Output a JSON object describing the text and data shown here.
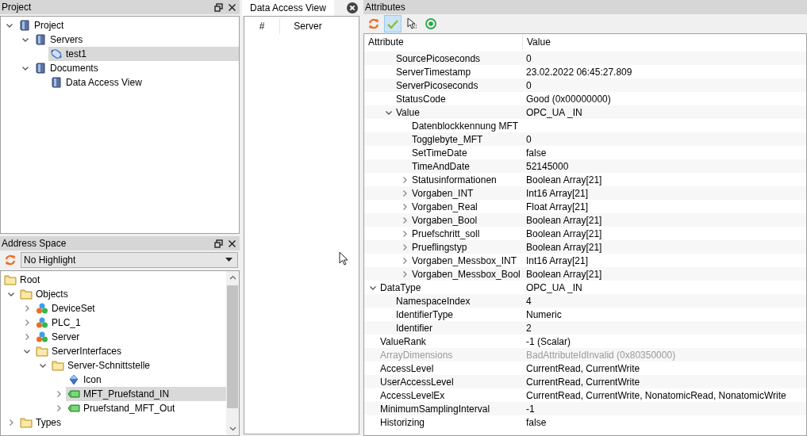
{
  "project_panel": {
    "title": "Project",
    "tree": [
      {
        "label": "Project",
        "kind": "book",
        "expanded": true,
        "selected": false,
        "children": [
          {
            "label": "Servers",
            "kind": "book",
            "expanded": true,
            "selected": false,
            "children": [
              {
                "label": "test1",
                "kind": "connection",
                "selected": true
              }
            ]
          },
          {
            "label": "Documents",
            "kind": "book",
            "expanded": true,
            "selected": false,
            "children": [
              {
                "label": "Data Access View",
                "kind": "book",
                "selected": false
              }
            ]
          }
        ]
      }
    ]
  },
  "address_space": {
    "title": "Address Space",
    "highlight": "No Highlight",
    "tree": [
      {
        "label": "Root",
        "kind": "folder",
        "selected": false,
        "children": [
          {
            "label": "Objects",
            "kind": "folder",
            "expanded": true,
            "selected": false,
            "children": [
              {
                "label": "DeviceSet",
                "kind": "object",
                "expanded": false,
                "selected": false
              },
              {
                "label": "PLC_1",
                "kind": "object",
                "expanded": false,
                "selected": false
              },
              {
                "label": "Server",
                "kind": "object",
                "expanded": false,
                "selected": false
              },
              {
                "label": "ServerInterfaces",
                "kind": "folder",
                "expanded": true,
                "selected": false,
                "children": [
                  {
                    "label": "Server-Schnittstelle",
                    "kind": "folder",
                    "expanded": true,
                    "selected": false,
                    "children": [
                      {
                        "label": "Icon",
                        "kind": "property",
                        "selected": false
                      },
                      {
                        "label": "MFT_Pruefstand_IN",
                        "kind": "variable",
                        "expanded": false,
                        "selected": true
                      },
                      {
                        "label": "Pruefstand_MFT_Out",
                        "kind": "variable",
                        "expanded": false,
                        "selected": false
                      }
                    ]
                  }
                ]
              }
            ]
          },
          {
            "label": "Types",
            "kind": "folder",
            "expanded": false,
            "selected": false
          }
        ]
      }
    ]
  },
  "data_access_view": {
    "tab": "Data Access View",
    "columns": [
      "#",
      "Server"
    ]
  },
  "attributes": {
    "title": "Attributes",
    "toolbar": [
      {
        "kind": "refresh",
        "on": false
      },
      {
        "kind": "check",
        "on": true
      },
      {
        "kind": "pointer",
        "on": false
      },
      {
        "kind": "target",
        "on": false
      }
    ],
    "columns": [
      "Attribute",
      "Value"
    ],
    "rows": [
      {
        "children": [
          {
            "name": "SourcePicoseconds",
            "value": "0",
            "disabled": false
          },
          {
            "name": "ServerTimestamp",
            "value": "23.02.2022 06:45:27.809",
            "disabled": false
          },
          {
            "name": "ServerPicoseconds",
            "value": "0",
            "disabled": false
          },
          {
            "name": "StatusCode",
            "value": "Good (0x00000000)",
            "disabled": false
          },
          {
            "name": "Value",
            "value": "OPC_UA _IN",
            "disabled": false,
            "expanded": true,
            "children": [
              {
                "name": "Datenblockkennung MFT",
                "disabled": false
              },
              {
                "name": "Togglebyte_MFT",
                "value": "0",
                "disabled": false
              },
              {
                "name": "SetTimeDate",
                "value": "false",
                "disabled": false
              },
              {
                "name": "TimeAndDate",
                "value": "52145000",
                "disabled": false
              },
              {
                "name": "Statusinformationen",
                "value": "Boolean Array[21]",
                "disabled": false,
                "expanded": false
              },
              {
                "name": "Vorgaben_INT",
                "value": "Int16 Array[21]",
                "disabled": false,
                "expanded": false
              },
              {
                "name": "Vorgaben_Real",
                "value": "Float Array[21]",
                "disabled": false,
                "expanded": false
              },
              {
                "name": "Vorgaben_Bool",
                "value": "Boolean Array[21]",
                "disabled": false,
                "expanded": false
              },
              {
                "name": "Pruefschritt_soll",
                "value": "Boolean Array[21]",
                "disabled": false,
                "expanded": false
              },
              {
                "name": "Prueflingstyp",
                "value": "Boolean Array[21]",
                "disabled": false,
                "expanded": false
              },
              {
                "name": "Vorgaben_Messbox_INT",
                "value": "Int16 Array[21]",
                "disabled": false,
                "expanded": false
              },
              {
                "name": "Vorgaben_Messbox_Bool",
                "value": "Boolean Array[21]",
                "disabled": false,
                "expanded": false
              }
            ]
          }
        ]
      },
      {
        "name": "DataType",
        "value": "OPC_UA _IN",
        "disabled": false,
        "expanded": true,
        "children": [
          {
            "name": "NamespaceIndex",
            "value": "4",
            "disabled": false
          },
          {
            "name": "IdentifierType",
            "value": "Numeric",
            "disabled": false
          },
          {
            "name": "Identifier",
            "value": "2",
            "disabled": false
          }
        ]
      },
      {
        "name": "ValueRank",
        "value": "-1 (Scalar)",
        "disabled": false
      },
      {
        "name": "ArrayDimensions",
        "value": "BadAttributeIdInvalid (0x80350000)",
        "disabled": true
      },
      {
        "name": "AccessLevel",
        "value": "CurrentRead, CurrentWrite",
        "disabled": false
      },
      {
        "name": "UserAccessLevel",
        "value": "CurrentRead, CurrentWrite",
        "disabled": false
      },
      {
        "name": "AccessLevelEx",
        "value": "CurrentRead, CurrentWrite, NonatomicRead, NonatomicWrite",
        "disabled": false
      },
      {
        "name": "MinimumSamplingInterval",
        "value": "-1",
        "disabled": false
      },
      {
        "name": "Historizing",
        "value": "false",
        "disabled": false
      }
    ]
  }
}
